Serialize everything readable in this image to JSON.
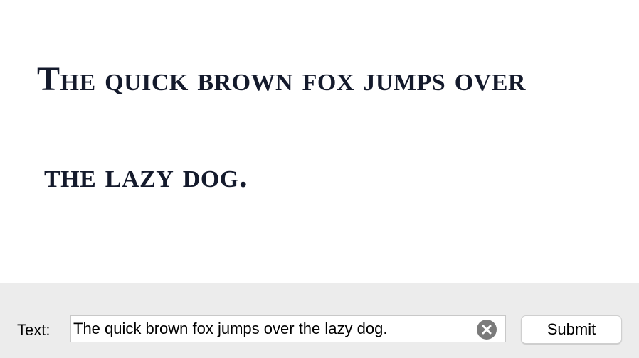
{
  "preview": {
    "line1": "The quick brown fox jumps over",
    "line2": "the lazy dog."
  },
  "form": {
    "label": "Text:",
    "text_value": "The quick brown fox jumps over the lazy dog.",
    "clear_icon": "clear-circle-x-icon",
    "submit_label": "Submit"
  },
  "colors": {
    "preview_text": "#141a2c",
    "controls_background": "#ececec",
    "clear_icon": "#7b7b7b"
  }
}
